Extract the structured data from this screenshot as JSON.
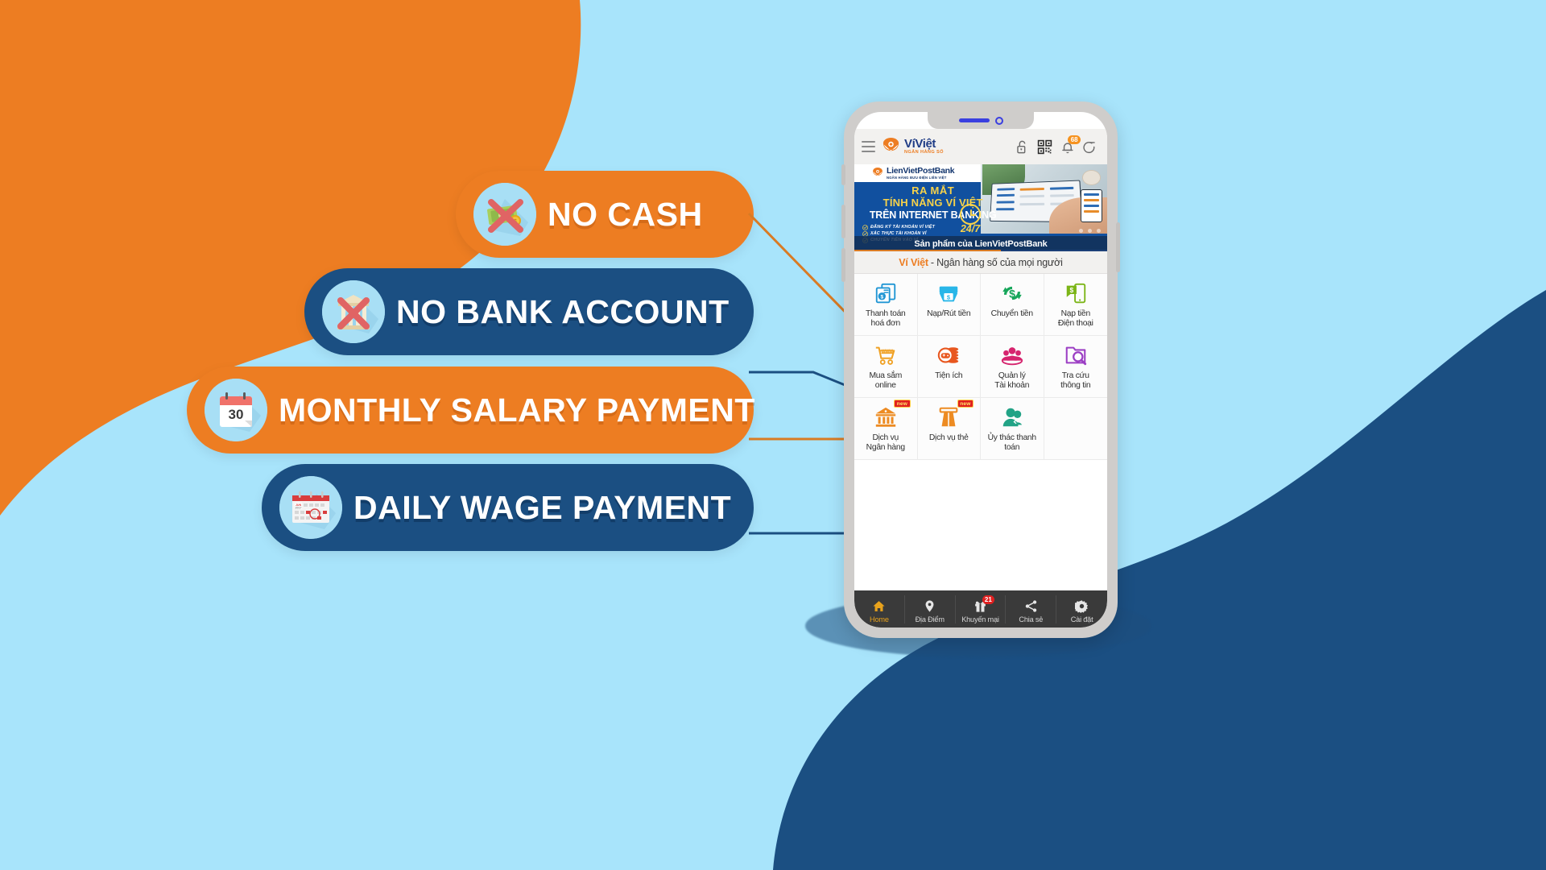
{
  "colors": {
    "background_blue": "#a8e4fb",
    "accent_orange": "#ed7d22",
    "deep_blue": "#1b4f82",
    "banner_blue": "#11509f",
    "nav_dark": "#3a3a3a",
    "badge_red": "#e02020",
    "badge_orange": "#f6921e",
    "highlight_yellow": "#e8a21c"
  },
  "features": [
    {
      "label": "NO CASH",
      "style": "orange",
      "icon": "crossed-out-cash-icon"
    },
    {
      "label": "NO BANK ACCOUNT",
      "style": "blue",
      "icon": "crossed-out-bank-icon"
    },
    {
      "label": "MONTHLY SALARY PAYMENT",
      "style": "orange",
      "icon": "calendar-day-30-icon"
    },
    {
      "label": "DAILY WAGE PAYMENT",
      "style": "blue",
      "icon": "calendar-month-icon"
    }
  ],
  "phone": {
    "notch": {
      "speaker": "speaker-grille-icon",
      "camera": "front-camera-icon"
    },
    "header": {
      "menu_icon": "hamburger-menu-icon",
      "brand_name": "VíViệt",
      "brand_sub": "NGÂN HÀNG SỐ",
      "brand_logo_icon": "viviet-logo-icon",
      "icons": [
        {
          "name": "unlock-icon",
          "badge": null
        },
        {
          "name": "qr-code-icon",
          "badge": null
        },
        {
          "name": "notification-bell-icon",
          "badge": "68"
        },
        {
          "name": "logout-icon",
          "badge": null
        }
      ]
    },
    "promo": {
      "bank_name": "LienVietPostBank",
      "bank_sub": "NGÂN HÀNG BƯU ĐIỆN LIÊN VIỆT",
      "line1": "RA MẮT",
      "line2": "TÍNH NĂNG VÍ VIỆT",
      "line3_prefix": "TRÊN ",
      "line3_strong": "INTERNET BANKING",
      "bullets": [
        "ĐĂNG KÝ TÀI KHOẢN VÍ VIỆT",
        "XÁC THỰC TÀI KHOẢN VÍ",
        "CHUYỂN TIỀN VÀO VÍ"
      ],
      "badge_247": "24/7",
      "caption": "Sản phẩm của LienVietPostBank"
    },
    "tagline": {
      "brand": "Ví Việt",
      "rest": "- Ngân hàng số của mọi người"
    },
    "grid": [
      [
        {
          "label": "Thanh toán\nhoá đơn",
          "icon": "bill-payment-icon",
          "color": "#2196d4",
          "new": false
        },
        {
          "label": "Nạp/Rút tiền",
          "icon": "deposit-withdraw-icon",
          "color": "#29b6e8",
          "new": false
        },
        {
          "label": "Chuyển tiền",
          "icon": "money-transfer-icon",
          "color": "#16a65a",
          "new": false
        },
        {
          "label": "Nạp tiền\nĐiện thoại",
          "icon": "mobile-topup-icon",
          "color": "#7cb518",
          "new": false
        }
      ],
      [
        {
          "label": "Mua sắm\nonline",
          "icon": "shopping-cart-www-icon",
          "color": "#f0a124",
          "new": false
        },
        {
          "label": "Tiện ích",
          "icon": "utilities-gamepad-icon",
          "color": "#e8571f",
          "new": false
        },
        {
          "label": "Quản lý\nTài khoản",
          "icon": "account-management-icon",
          "color": "#d6246e",
          "new": false
        },
        {
          "label": "Tra cứu\nthông tin",
          "icon": "search-info-icon",
          "color": "#9c3fc4",
          "new": false
        }
      ],
      [
        {
          "label": "Dịch vụ\nNgân hàng",
          "icon": "bank-services-icon",
          "color": "#ed8b22",
          "new": true,
          "new_label": "new"
        },
        {
          "label": "Dịch vụ thẻ",
          "icon": "card-services-atm-icon",
          "color": "#ed8b22",
          "new": true,
          "new_label": "new"
        },
        {
          "label": "Ủy thác thanh\ntoán",
          "icon": "payment-trust-icon",
          "color": "#22a386",
          "new": false
        }
      ]
    ],
    "bottom_nav": [
      {
        "label": "Home",
        "icon": "home-icon",
        "active": true,
        "badge": null
      },
      {
        "label": "Địa Điểm",
        "icon": "location-pin-icon",
        "active": false,
        "badge": null
      },
      {
        "label": "Khuyến mại",
        "icon": "gift-promo-icon",
        "active": false,
        "badge": "21"
      },
      {
        "label": "Chia sẻ",
        "icon": "share-icon",
        "active": false,
        "badge": null
      },
      {
        "label": "Cài đặt",
        "icon": "settings-gear-icon",
        "active": false,
        "badge": null
      }
    ]
  }
}
